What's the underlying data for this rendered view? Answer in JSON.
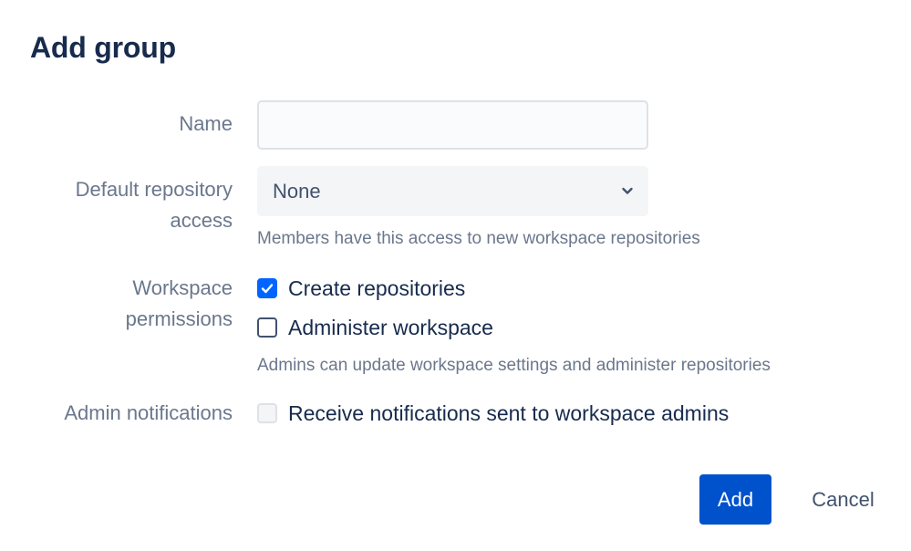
{
  "dialog": {
    "title": "Add group"
  },
  "fields": {
    "name": {
      "label": "Name",
      "value": "",
      "placeholder": ""
    },
    "default_access": {
      "label_line1": "Default repository",
      "label_line2": "access",
      "selected": "None",
      "helper": "Members have this access to new workspace repositories"
    },
    "workspace_permissions": {
      "label_line1": "Workspace",
      "label_line2": "permissions",
      "options": [
        {
          "label": "Create repositories",
          "checked": true
        },
        {
          "label": "Administer workspace",
          "checked": false
        }
      ],
      "helper": "Admins can update workspace settings and administer repositories"
    },
    "admin_notifications": {
      "label": "Admin notifications",
      "option": {
        "label": "Receive notifications sent to workspace admins",
        "checked": false,
        "disabled": true
      }
    }
  },
  "actions": {
    "add_label": "Add",
    "cancel_label": "Cancel"
  },
  "colors": {
    "primary": "#0052cc",
    "checkbox_checked": "#0065ff",
    "heading": "#172b4d",
    "label": "#6b778c"
  },
  "icons": {
    "select_chevron": "chevron-down-icon",
    "checkmark": "check-icon"
  }
}
